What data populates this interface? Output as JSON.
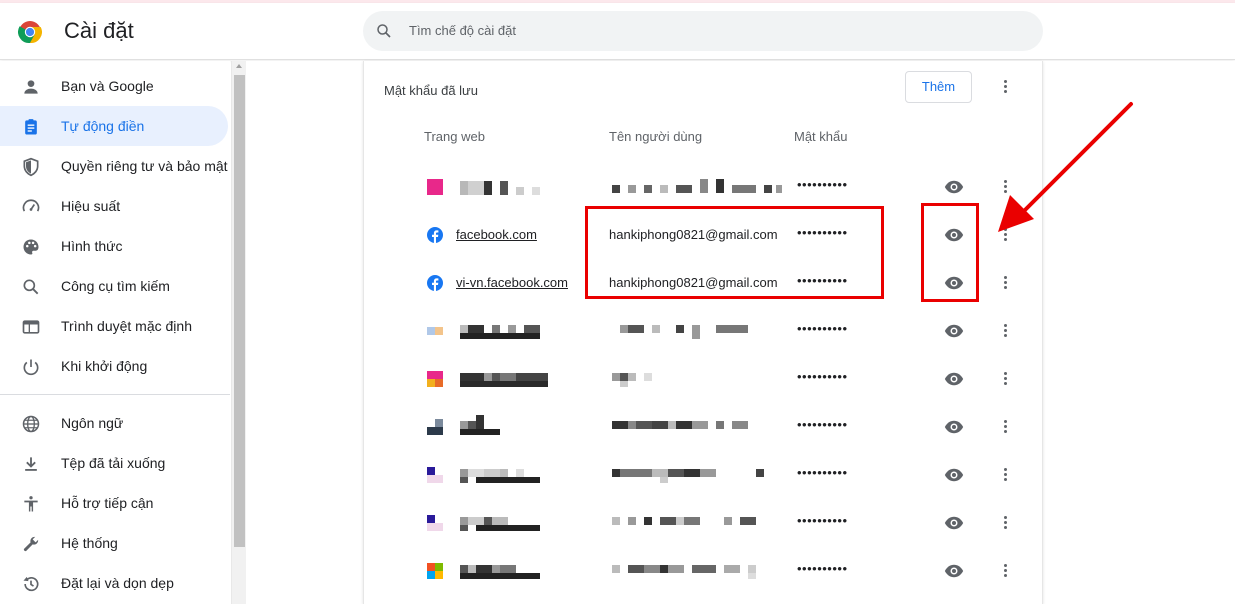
{
  "header": {
    "title": "Cài đặt",
    "search_placeholder": "Tìm chế độ cài đặt"
  },
  "sidebar": {
    "items": [
      {
        "label": "Bạn và Google",
        "icon": "person-icon"
      },
      {
        "label": "Tự động điền",
        "icon": "assignment-icon",
        "active": true
      },
      {
        "label": "Quyền riêng tư và bảo mật",
        "icon": "shield-icon"
      },
      {
        "label": "Hiệu suất",
        "icon": "speed-icon"
      },
      {
        "label": "Hình thức",
        "icon": "palette-icon"
      },
      {
        "label": "Công cụ tìm kiếm",
        "icon": "search-icon"
      },
      {
        "label": "Trình duyệt mặc định",
        "icon": "browser-icon"
      },
      {
        "label": "Khi khởi động",
        "icon": "power-icon"
      },
      {
        "label": "Ngôn ngữ",
        "icon": "globe-icon"
      },
      {
        "label": "Tệp đã tải xuống",
        "icon": "download-icon"
      },
      {
        "label": "Hỗ trợ tiếp cận",
        "icon": "accessibility-icon"
      },
      {
        "label": "Hệ thống",
        "icon": "wrench-icon"
      },
      {
        "label": "Đặt lại và dọn dẹp",
        "icon": "history-icon"
      }
    ]
  },
  "passwords": {
    "section_title": "Mật khẩu đã lưu",
    "add_label": "Thêm",
    "columns": {
      "site": "Trang web",
      "user": "Tên người dùng",
      "password": "Mật khẩu"
    },
    "rows": [
      {
        "site": "",
        "user": "",
        "password": "••••••••••",
        "favicon": "blurred"
      },
      {
        "site": "facebook.com",
        "user": "hankiphong0821@gmail.com",
        "password": "••••••••••",
        "favicon": "facebook-icon"
      },
      {
        "site": "vi-vn.facebook.com",
        "user": "hankiphong0821@gmail.com",
        "password": "••••••••••",
        "favicon": "facebook-icon"
      },
      {
        "site": "",
        "user": "",
        "password": "••••••••••",
        "favicon": "blurred"
      },
      {
        "site": "",
        "user": "",
        "password": "••••••••••",
        "favicon": "blurred"
      },
      {
        "site": "",
        "user": "",
        "password": "••••••••••",
        "favicon": "blurred"
      },
      {
        "site": "",
        "user": "",
        "password": "••••••••••",
        "favicon": "blurred"
      },
      {
        "site": "",
        "user": "",
        "password": "••••••••••",
        "favicon": "blurred"
      },
      {
        "site": "",
        "user": "",
        "password": "••••••••••",
        "favicon": "blurred"
      }
    ]
  },
  "colors": {
    "accent": "#1a73e8",
    "active_nav_bg": "#e8f0fe",
    "annotation": "#ea0000",
    "facebook": "#1877f2"
  }
}
